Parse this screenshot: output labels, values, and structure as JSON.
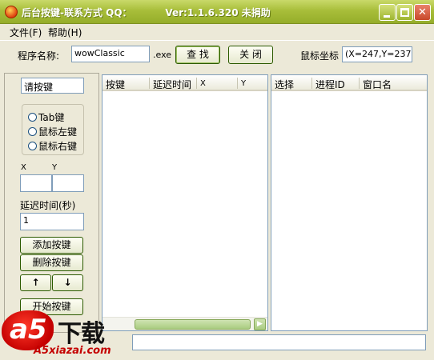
{
  "window": {
    "title": "后台按键-联系方式 QQ：          Ver:1.1.6.320 未捐助"
  },
  "menu": {
    "file": "文件(F)",
    "help": "帮助(H)"
  },
  "toolbar": {
    "program_label": "程序名称:",
    "program_value": "wowClassic",
    "ext_label": ".exe",
    "find_button": "查 找",
    "close_button": "关 闭",
    "mouse_label": "鼠标坐标",
    "mouse_value": "(X=247,Y=237)"
  },
  "left_panel": {
    "key_placeholder": "请按键",
    "radio_tab": "Tab键",
    "radio_left": "鼠标左键",
    "radio_right": "鼠标右键",
    "x_label": "X",
    "y_label": "Y",
    "delay_label": "延迟时间(秒)",
    "delay_value": "1",
    "add_button": "添加按键",
    "delete_button": "删除按键",
    "up_button": "↑",
    "down_button": "↓",
    "start_button": "开始按键"
  },
  "key_list": {
    "columns": [
      "按键",
      "延迟时间",
      "X",
      "Y"
    ]
  },
  "process_list": {
    "columns": [
      "选择",
      "进程ID",
      "窗口名"
    ]
  },
  "watermark": {
    "logo": "a5",
    "brand": "下载",
    "url": "A5xiazai.com"
  },
  "colors": {
    "titlebar": "#a8be3a",
    "face": "#ece9d8",
    "field_border": "#7f9db9"
  }
}
